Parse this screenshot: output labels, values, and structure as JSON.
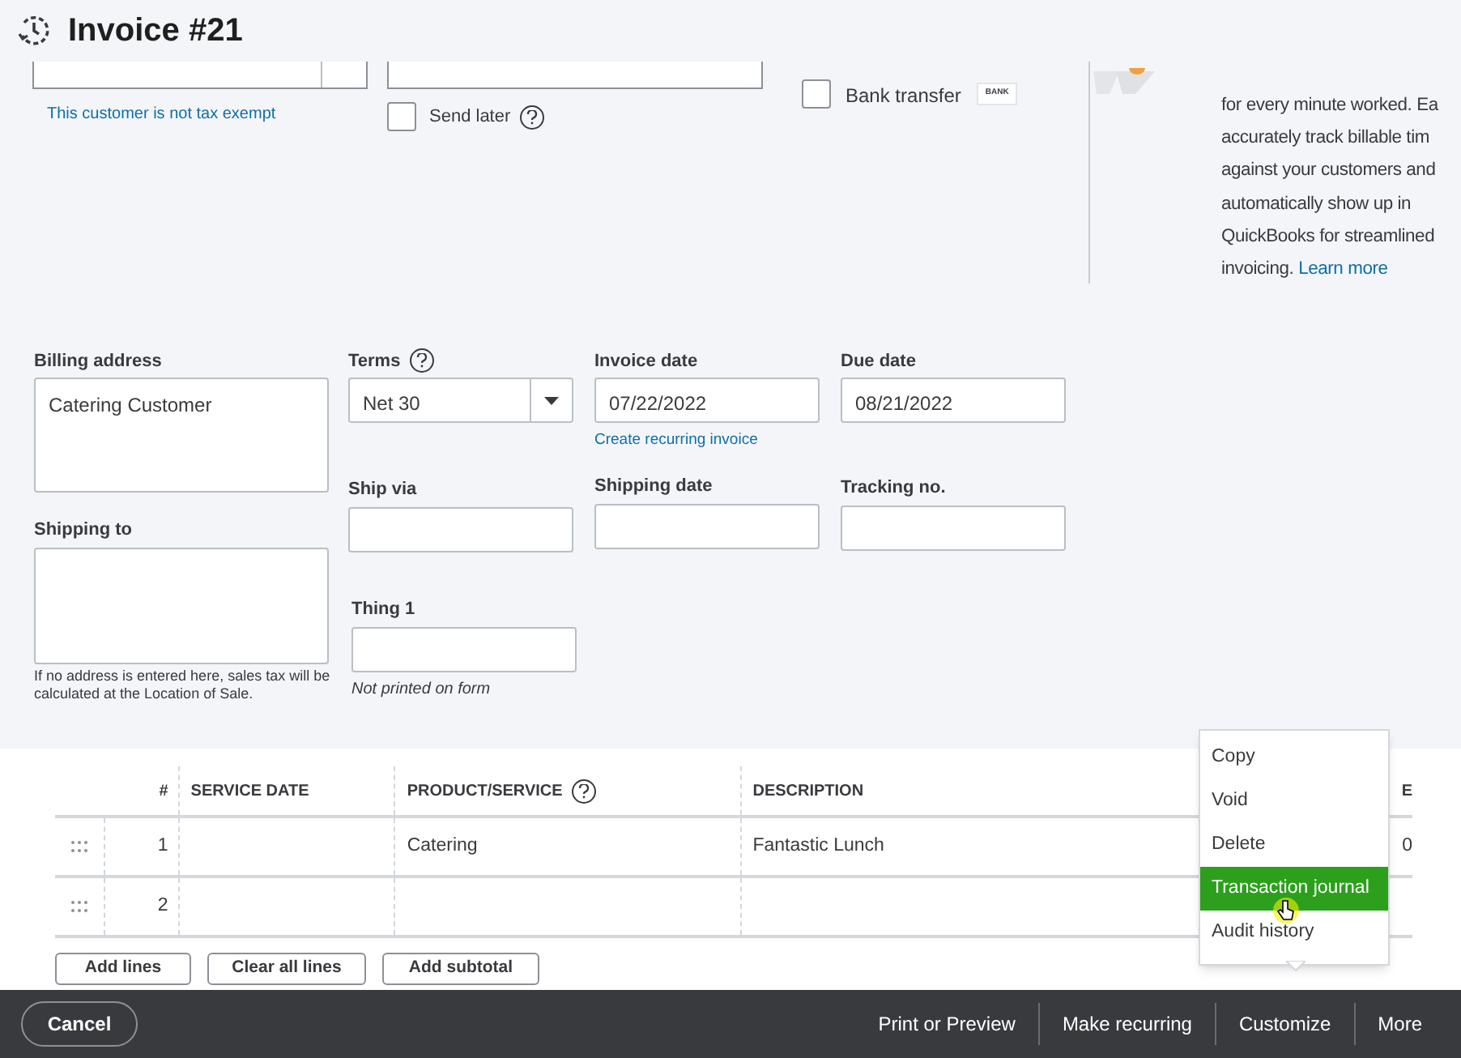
{
  "header": {
    "title": "Invoice #21"
  },
  "top": {
    "tax_note": "This customer is not tax exempt",
    "send_later": {
      "label": "Send later",
      "checked": false
    },
    "bank_transfer": {
      "label": "Bank transfer",
      "checked": false,
      "badge": "BANK"
    }
  },
  "promo": {
    "lines": [
      "for every minute worked. Ea",
      "accurately track billable tim",
      "against your customers and",
      "automatically show up in",
      "QuickBooks for streamlined",
      "invoicing."
    ],
    "link": "Learn more"
  },
  "form": {
    "billing_address": {
      "label": "Billing address",
      "value": "Catering Customer"
    },
    "terms": {
      "label": "Terms",
      "value": "Net 30"
    },
    "invoice_date": {
      "label": "Invoice date",
      "value": "07/22/2022",
      "link": "Create recurring invoice"
    },
    "due_date": {
      "label": "Due date",
      "value": "08/21/2022"
    },
    "ship_via": {
      "label": "Ship via"
    },
    "shipping_date": {
      "label": "Shipping date"
    },
    "tracking_no": {
      "label": "Tracking no."
    },
    "shipping_to": {
      "label": "Shipping to",
      "note": "If no address is entered here, sales tax will be calculated at the Location of Sale."
    },
    "thing_1": {
      "label": "Thing 1",
      "note": "Not printed on form"
    }
  },
  "table": {
    "columns": [
      "#",
      "SERVICE DATE",
      "PRODUCT/SERVICE",
      "DESCRIPTION",
      "E"
    ],
    "rows": [
      {
        "number": "1",
        "product": "Catering",
        "description": "Fantastic Lunch",
        "column_5": "0"
      },
      {
        "number": "2"
      }
    ],
    "buttons": [
      "Add lines",
      "Clear all lines",
      "Add subtotal"
    ]
  },
  "more_menu": {
    "items": [
      {
        "label": "Copy",
        "selected": false
      },
      {
        "label": "Void",
        "selected": false
      },
      {
        "label": "Delete",
        "selected": false
      },
      {
        "label": "Transaction journal",
        "selected": true
      },
      {
        "label": "Audit history",
        "selected": false
      }
    ]
  },
  "footer": {
    "cancel": "Cancel",
    "actions": [
      "Print or Preview",
      "Make recurring",
      "Customize",
      "More"
    ]
  }
}
